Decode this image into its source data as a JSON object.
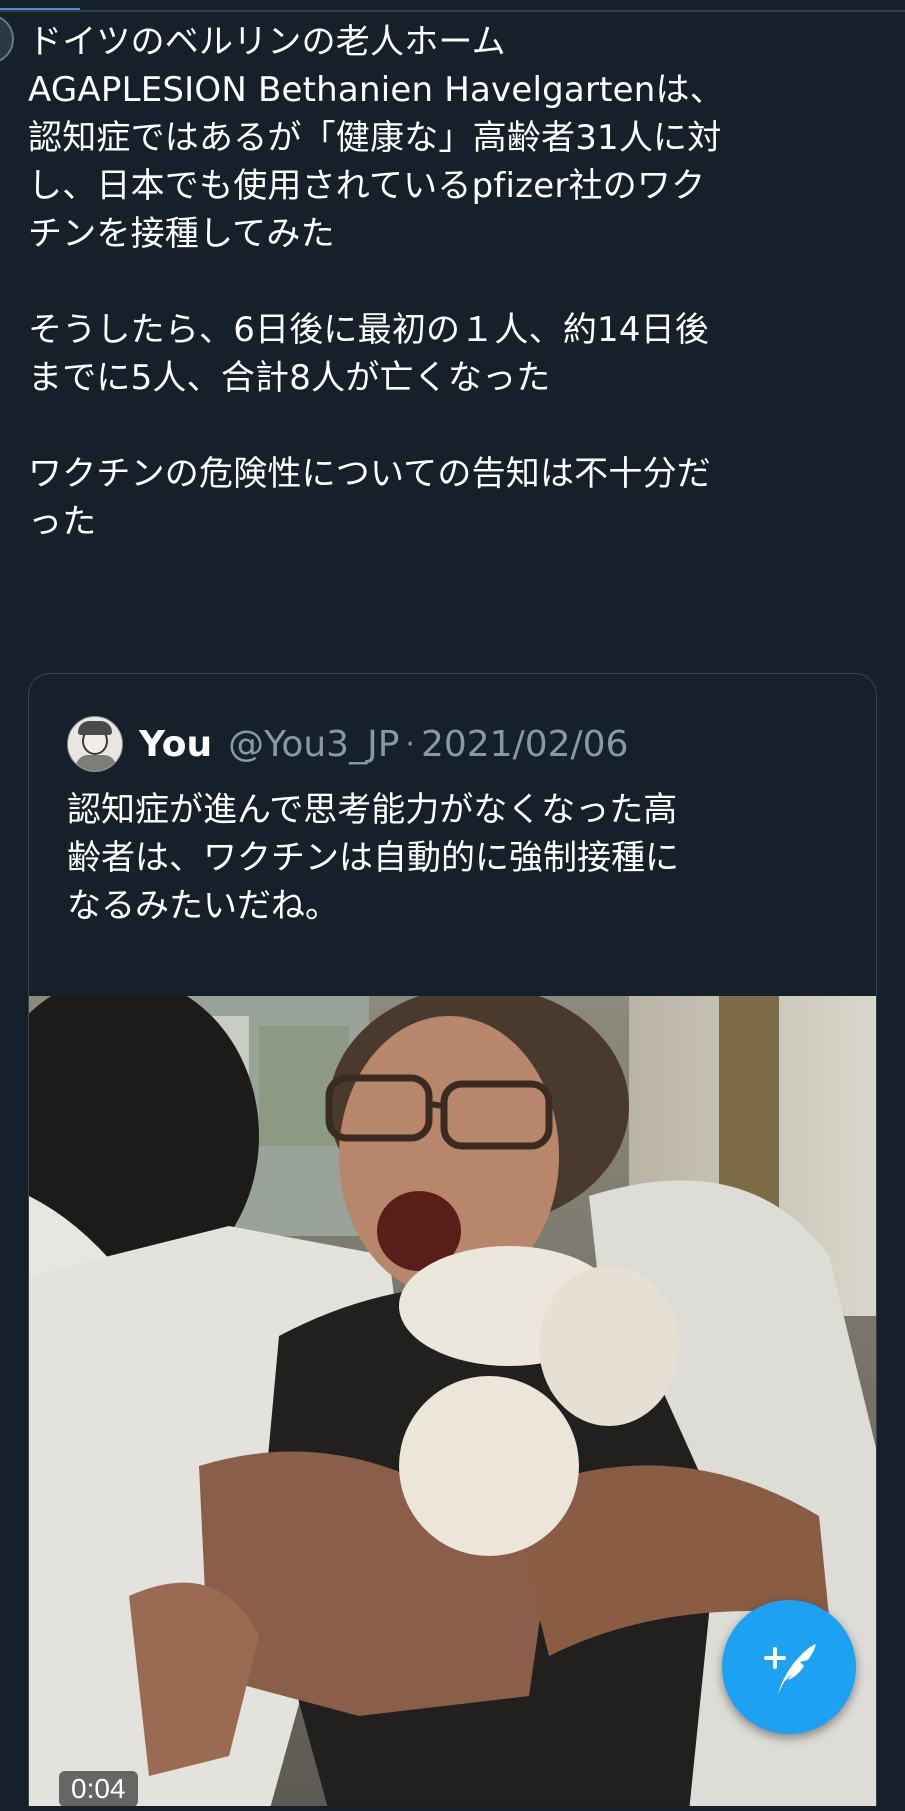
{
  "tweet": {
    "text": "ドイツのベルリンの老人ホーム\nAGAPLESION Bethanien Havelgartenは、\n認知症ではあるが「健康な」高齢者31人に対\nし、日本でも使用されているpfizer社のワク\nチンを接種してみた\n\nそうしたら、6日後に最初の１人、約14日後\nまでに5人、合計8人が亡くなった\n\nワクチンの危険性についての告知は不十分だ\nった"
  },
  "quote": {
    "name": "You",
    "handle": "@You3_JP",
    "separator": "·",
    "date": "2021/02/06",
    "text": "認知症が進んで思考能力がなくなった高\n齢者は、ワクチンは自動的に強制接種に\nなるみたいだね。",
    "video_duration": "0:04"
  },
  "icons": {
    "compose": "compose-tweet-icon",
    "avatar": "user-avatar-icon"
  },
  "colors": {
    "background": "#15202b",
    "border": "#38444d",
    "secondary_text": "#8899a6",
    "accent": "#1da1f2"
  }
}
